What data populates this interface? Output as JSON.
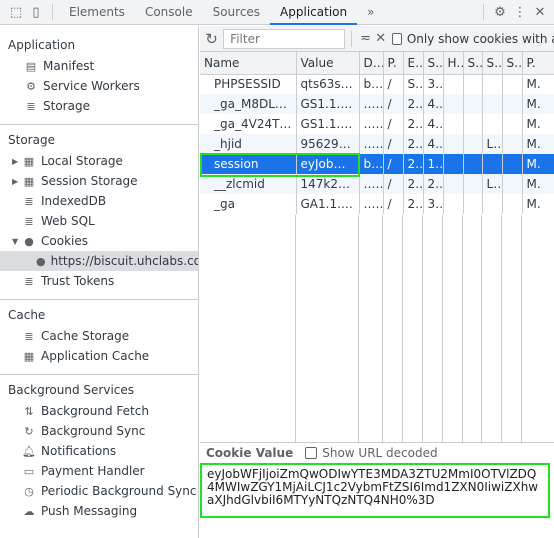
{
  "topbar": {
    "tabs": [
      "Elements",
      "Console",
      "Sources",
      "Application"
    ],
    "active": "Application",
    "more": "»"
  },
  "sidebar": {
    "application": {
      "title": "Application",
      "items": [
        "Manifest",
        "Service Workers",
        "Storage"
      ]
    },
    "storage": {
      "title": "Storage",
      "items": [
        "Local Storage",
        "Session Storage",
        "IndexedDB",
        "Web SQL",
        "Cookies",
        "https://biscuit.uhclabs.com",
        "Trust Tokens"
      ]
    },
    "cache": {
      "title": "Cache",
      "items": [
        "Cache Storage",
        "Application Cache"
      ]
    },
    "background": {
      "title": "Background Services",
      "items": [
        "Background Fetch",
        "Background Sync",
        "Notifications",
        "Payment Handler",
        "Periodic Background Sync",
        "Push Messaging"
      ]
    }
  },
  "toolbar": {
    "filter_placeholder": "Filter",
    "only_show": "Only show cookies with an issue"
  },
  "table": {
    "headers": [
      "Name",
      "Value",
      "D...",
      "P.",
      "E.",
      "S.",
      "H.",
      "S.",
      "S.",
      "S.",
      "P."
    ],
    "rows": [
      [
        "PHPSESSID",
        "qts63s…",
        "b…",
        "/",
        "S…",
        "3…",
        "",
        "",
        "",
        "",
        "M."
      ],
      [
        "_ga_M8DL0…",
        "GS1.1.1…",
        "….",
        "/",
        "2…",
        "4…",
        "",
        "",
        "",
        "",
        "M."
      ],
      [
        "_ga_4V24T…",
        "GS1.1.1…",
        "….",
        "/",
        "2…",
        "4…",
        "",
        "",
        "",
        "",
        "M."
      ],
      [
        "_hjid",
        "956290…",
        "….",
        "/",
        "2…",
        "4…",
        "",
        "",
        "L…",
        "",
        "M."
      ],
      [
        "session",
        "eyJob…",
        "b…",
        "/",
        "2…",
        "1…",
        "",
        "",
        "",
        "",
        "M."
      ],
      [
        "__zlcmid",
        "147k25…",
        "….",
        "/",
        "2…",
        "2…",
        "",
        "",
        "L…",
        "",
        "M."
      ],
      [
        "_ga",
        "GA1.1.…",
        "….",
        "/",
        "2…",
        "3…",
        "",
        "",
        "",
        "",
        "M."
      ]
    ],
    "selected": "session"
  },
  "cookie_value": {
    "label": "Cookie Value",
    "show_decoded": "Show URL decoded",
    "value": "eyJobWFjIjoiZmQwODIwYTE3MDA3ZTU2MmI0OTVlZDQ4MWIwZGY1MjAiLCJ1c2VybmFtZSI6Imd1ZXN0IiwiZXhwaXJhdGlvbiI6MTYyNTQzNTQ4NH0%3D"
  }
}
